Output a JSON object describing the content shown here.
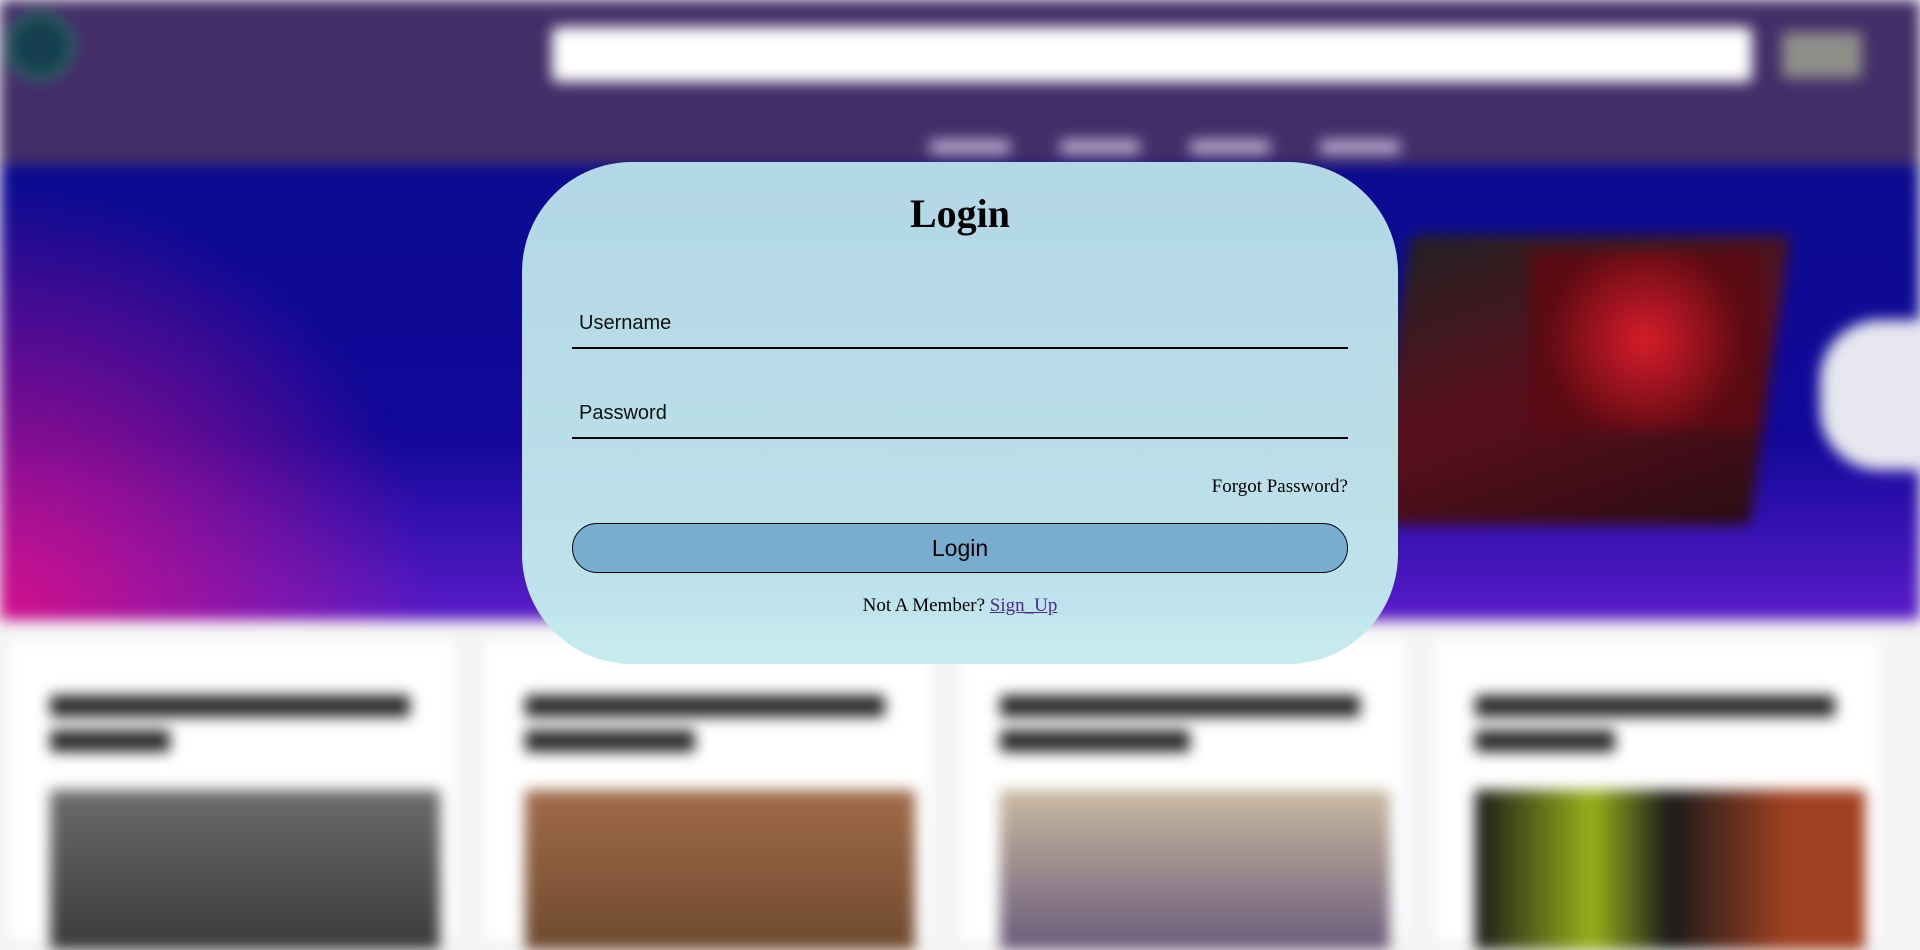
{
  "modal": {
    "title": "Login",
    "username_placeholder": "Username",
    "password_placeholder": "Password",
    "forgot_password": "Forgot Password?",
    "login_button": "Login",
    "not_member_text": "Not A Member?",
    "sign_up_link": "Sign_Up"
  },
  "colors": {
    "header_bg": "#432e68",
    "hero_bg": "#0b0b90",
    "modal_bg": "#b8dee8",
    "login_button_bg": "#78adcf",
    "link_color": "#4a2a8a"
  },
  "background_icons": [
    "logo-icon",
    "laptop-image",
    "gamepad-image"
  ]
}
